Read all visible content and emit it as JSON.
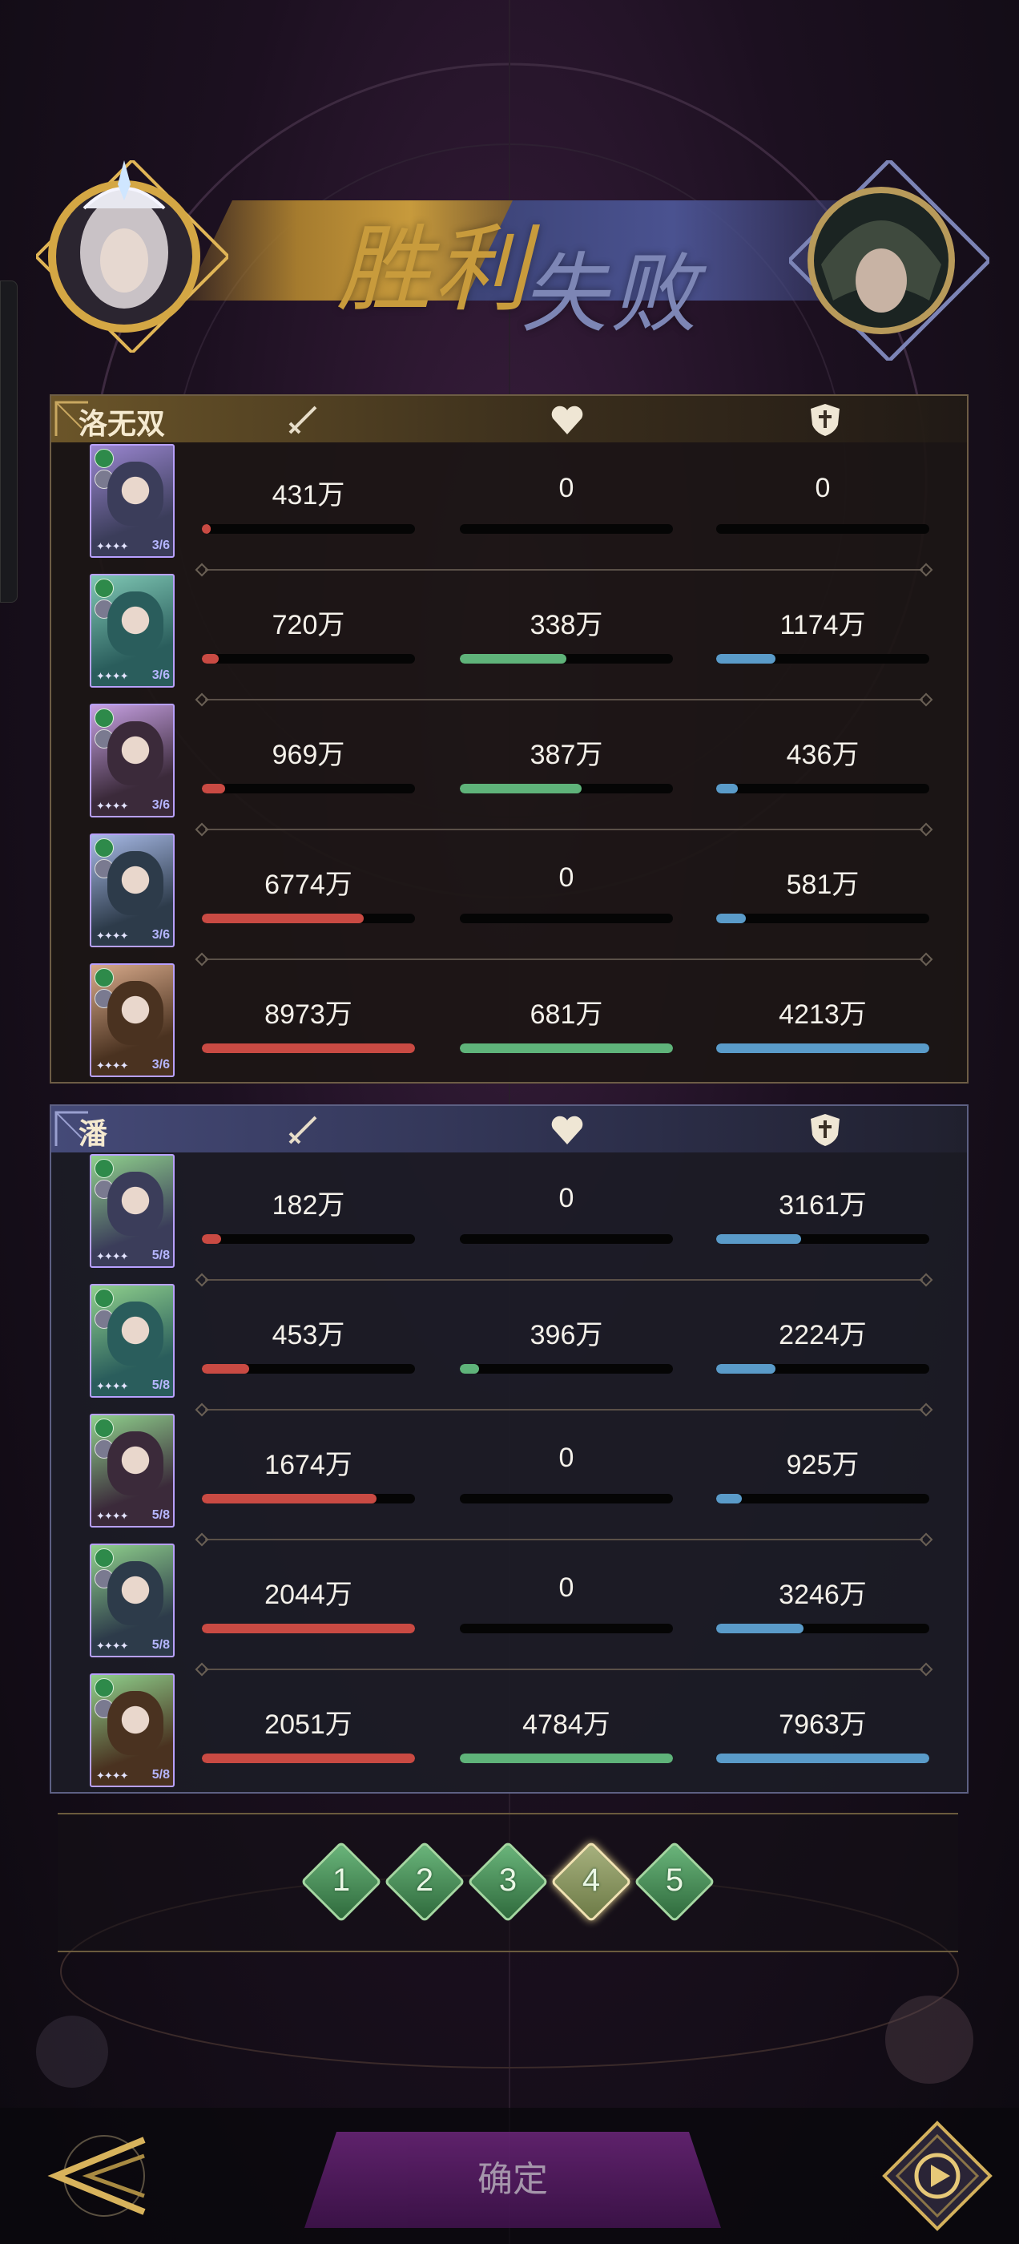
{
  "header": {
    "result_win": "胜利",
    "result_lose": "失败"
  },
  "teams": [
    {
      "player": "洛无双",
      "result": "win",
      "rows": [
        {
          "damage": "431万",
          "heal": "0",
          "tank": "0",
          "damage_pct": 4,
          "heal_pct": 0,
          "tank_pct": 0,
          "level": "3/6"
        },
        {
          "damage": "720万",
          "heal": "338万",
          "tank": "1174万",
          "damage_pct": 8,
          "heal_pct": 50,
          "tank_pct": 28,
          "level": "3/6"
        },
        {
          "damage": "969万",
          "heal": "387万",
          "tank": "436万",
          "damage_pct": 11,
          "heal_pct": 57,
          "tank_pct": 10,
          "level": "3/6"
        },
        {
          "damage": "6774万",
          "heal": "0",
          "tank": "581万",
          "damage_pct": 76,
          "heal_pct": 0,
          "tank_pct": 14,
          "level": "3/6"
        },
        {
          "damage": "8973万",
          "heal": "681万",
          "tank": "4213万",
          "damage_pct": 100,
          "heal_pct": 100,
          "tank_pct": 100,
          "level": "3/6"
        }
      ]
    },
    {
      "player": "潘",
      "result": "lose",
      "rows": [
        {
          "damage": "182万",
          "heal": "0",
          "tank": "3161万",
          "damage_pct": 9,
          "heal_pct": 0,
          "tank_pct": 40,
          "level": "5/8"
        },
        {
          "damage": "453万",
          "heal": "396万",
          "tank": "2224万",
          "damage_pct": 22,
          "heal_pct": 9,
          "tank_pct": 28,
          "level": "5/8"
        },
        {
          "damage": "1674万",
          "heal": "0",
          "tank": "925万",
          "damage_pct": 82,
          "heal_pct": 0,
          "tank_pct": 12,
          "level": "5/8"
        },
        {
          "damage": "2044万",
          "heal": "0",
          "tank": "3246万",
          "damage_pct": 100,
          "heal_pct": 0,
          "tank_pct": 41,
          "level": "5/8"
        },
        {
          "damage": "2051万",
          "heal": "4784万",
          "tank": "7963万",
          "damage_pct": 100,
          "heal_pct": 100,
          "tank_pct": 100,
          "level": "5/8"
        }
      ]
    }
  ],
  "pager": {
    "pages": [
      "1",
      "2",
      "3",
      "4",
      "5"
    ],
    "active": "4"
  },
  "footer": {
    "confirm_label": "确定"
  },
  "colors": {
    "damage": "#c94a43",
    "heal": "#5fb37a",
    "tank": "#5a9bc9",
    "win_gold": "#c89b3c",
    "lose_blue": "#7d86b5"
  },
  "icons": {
    "damage": "sword-icon",
    "heal": "heart-icon",
    "tank": "shield-icon"
  }
}
